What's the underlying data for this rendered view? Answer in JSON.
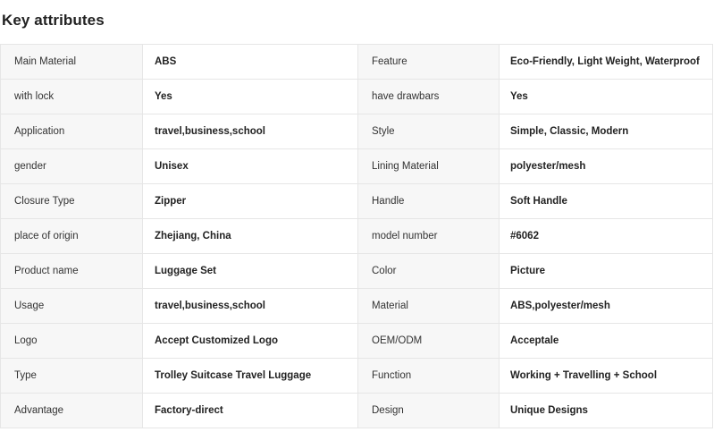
{
  "section": {
    "title": "Key attributes"
  },
  "attributes": [
    {
      "k1": "Main Material",
      "v1": "ABS",
      "k2": "Feature",
      "v2": "Eco-Friendly, Light Weight, Waterproof"
    },
    {
      "k1": "with lock",
      "v1": "Yes",
      "k2": "have drawbars",
      "v2": "Yes"
    },
    {
      "k1": "Application",
      "v1": "travel,business,school",
      "k2": "Style",
      "v2": "Simple, Classic, Modern"
    },
    {
      "k1": "gender",
      "v1": "Unisex",
      "k2": "Lining Material",
      "v2": "polyester/mesh"
    },
    {
      "k1": "Closure Type",
      "v1": "Zipper",
      "k2": "Handle",
      "v2": "Soft Handle"
    },
    {
      "k1": "place of origin",
      "v1": "Zhejiang, China",
      "k2": "model number",
      "v2": "#6062"
    },
    {
      "k1": "Product name",
      "v1": "Luggage Set",
      "k2": "Color",
      "v2": "Picture"
    },
    {
      "k1": "Usage",
      "v1": "travel,business,school",
      "k2": "Material",
      "v2": "ABS,polyester/mesh"
    },
    {
      "k1": "Logo",
      "v1": "Accept Customized Logo",
      "k2": "OEM/ODM",
      "v2": "Acceptale"
    },
    {
      "k1": "Type",
      "v1": "Trolley Suitcase Travel Luggage",
      "k2": "Function",
      "v2": "Working + Travelling + School"
    },
    {
      "k1": "Advantage",
      "v1": "Factory-direct",
      "k2": "Design",
      "v2": "Unique Designs"
    }
  ]
}
